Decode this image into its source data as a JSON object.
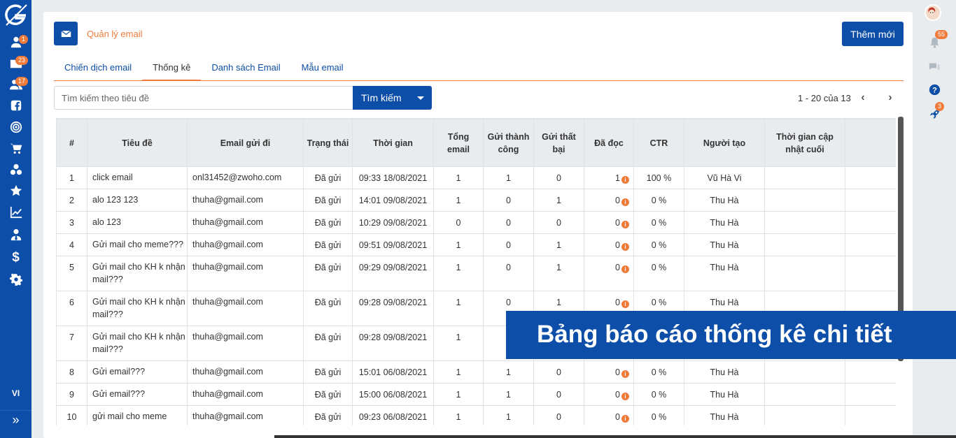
{
  "sidebar": {
    "items": [
      {
        "name": "contacts-icon",
        "badge": "1"
      },
      {
        "name": "folder-icon",
        "badge": "23"
      },
      {
        "name": "users-icon",
        "badge": "17"
      },
      {
        "name": "facebook-icon",
        "badge": ""
      },
      {
        "name": "target-icon",
        "badge": ""
      },
      {
        "name": "cart-icon",
        "badge": ""
      },
      {
        "name": "network-icon",
        "badge": ""
      },
      {
        "name": "star-icon",
        "badge": ""
      },
      {
        "name": "chart-icon",
        "badge": ""
      },
      {
        "name": "user-tie-icon",
        "badge": ""
      },
      {
        "name": "dollar-icon",
        "badge": ""
      },
      {
        "name": "gear-icon",
        "badge": ""
      }
    ],
    "language": "VI",
    "expand_icon": "»"
  },
  "rail": {
    "notifications_badge": "55",
    "rocket_badge": "3"
  },
  "header": {
    "title": "Quản lý email",
    "add_button": "Thêm mới"
  },
  "tabs": [
    {
      "label": "Chiến dịch email"
    },
    {
      "label": "Thống kê"
    },
    {
      "label": "Danh sách Email"
    },
    {
      "label": "Mẫu email"
    }
  ],
  "search": {
    "placeholder": "Tìm kiếm theo tiêu đề",
    "button": "Tìm kiếm"
  },
  "pagination": {
    "text": "1 - 20 của 13",
    "prev": "‹",
    "next": "›"
  },
  "table": {
    "headers": [
      "#",
      "Tiêu đề",
      "Email gửi đi",
      "Trạng thái",
      "Thời gian",
      "Tổng email",
      "Gửi thành công",
      "Gửi thất bại",
      "Đã đọc",
      "CTR",
      "Người tạo",
      "Thời gian cập nhật cuối",
      ""
    ],
    "rows": [
      {
        "no": "1",
        "title": "click email",
        "email": "onl31452@zwoho.com",
        "status": "Đã gửi",
        "time": "09:33 18/08/2021",
        "total": "1",
        "success": "1",
        "failed": "0",
        "read": "1",
        "ctr": "100 %",
        "creator": "Vũ Hà Vi",
        "updated": ""
      },
      {
        "no": "2",
        "title": "alo 123 123",
        "email": "thuha@gmail.com",
        "status": "Đã gửi",
        "time": "14:01 09/08/2021",
        "total": "1",
        "success": "0",
        "failed": "1",
        "read": "0",
        "ctr": "0 %",
        "creator": "Thu Hà",
        "updated": ""
      },
      {
        "no": "3",
        "title": "alo 123",
        "email": "thuha@gmail.com",
        "status": "Đã gửi",
        "time": "10:29 09/08/2021",
        "total": "0",
        "success": "0",
        "failed": "0",
        "read": "0",
        "ctr": "0 %",
        "creator": "Thu Hà",
        "updated": ""
      },
      {
        "no": "4",
        "title": "Gửi mail cho meme???",
        "email": "thuha@gmail.com",
        "status": "Đã gửi",
        "time": "09:51 09/08/2021",
        "total": "1",
        "success": "0",
        "failed": "1",
        "read": "0",
        "ctr": "0 %",
        "creator": "Thu Hà",
        "updated": ""
      },
      {
        "no": "5",
        "title": "Gửi mail cho KH k nhận mail???",
        "email": "thuha@gmail.com",
        "status": "Đã gửi",
        "time": "09:29 09/08/2021",
        "total": "1",
        "success": "0",
        "failed": "1",
        "read": "0",
        "ctr": "0 %",
        "creator": "Thu Hà",
        "updated": ""
      },
      {
        "no": "6",
        "title": "Gửi mail cho KH k nhận mail???",
        "email": "thuha@gmail.com",
        "status": "Đã gửi",
        "time": "09:28 09/08/2021",
        "total": "1",
        "success": "0",
        "failed": "1",
        "read": "0",
        "ctr": "0 %",
        "creator": "Thu Hà",
        "updated": ""
      },
      {
        "no": "7",
        "title": "Gửi mail cho KH k nhận mail???",
        "email": "thuha@gmail.com",
        "status": "Đã gửi",
        "time": "09:28 09/08/2021",
        "total": "1",
        "success": "",
        "failed": "",
        "read": "",
        "ctr": "",
        "creator": "",
        "updated": ""
      },
      {
        "no": "8",
        "title": "Gửi email???",
        "email": "thuha@gmail.com",
        "status": "Đã gửi",
        "time": "15:01 06/08/2021",
        "total": "1",
        "success": "1",
        "failed": "0",
        "read": "0",
        "ctr": "0 %",
        "creator": "Thu Hà",
        "updated": ""
      },
      {
        "no": "9",
        "title": "Gửi email???",
        "email": "thuha@gmail.com",
        "status": "Đã gửi",
        "time": "15:00 06/08/2021",
        "total": "1",
        "success": "1",
        "failed": "0",
        "read": "0",
        "ctr": "0 %",
        "creator": "Thu Hà",
        "updated": ""
      },
      {
        "no": "10",
        "title": "gửi mail cho meme",
        "email": "thuha@gmail.com",
        "status": "Đã gửi",
        "time": "09:23 06/08/2021",
        "total": "1",
        "success": "1",
        "failed": "0",
        "read": "0",
        "ctr": "0 %",
        "creator": "Thu Hà",
        "updated": ""
      }
    ]
  },
  "banner": {
    "text": "Bảng báo cáo thống kê chi tiết"
  },
  "colors": {
    "primary": "#0d4fa8",
    "accent": "#f07a3a"
  }
}
